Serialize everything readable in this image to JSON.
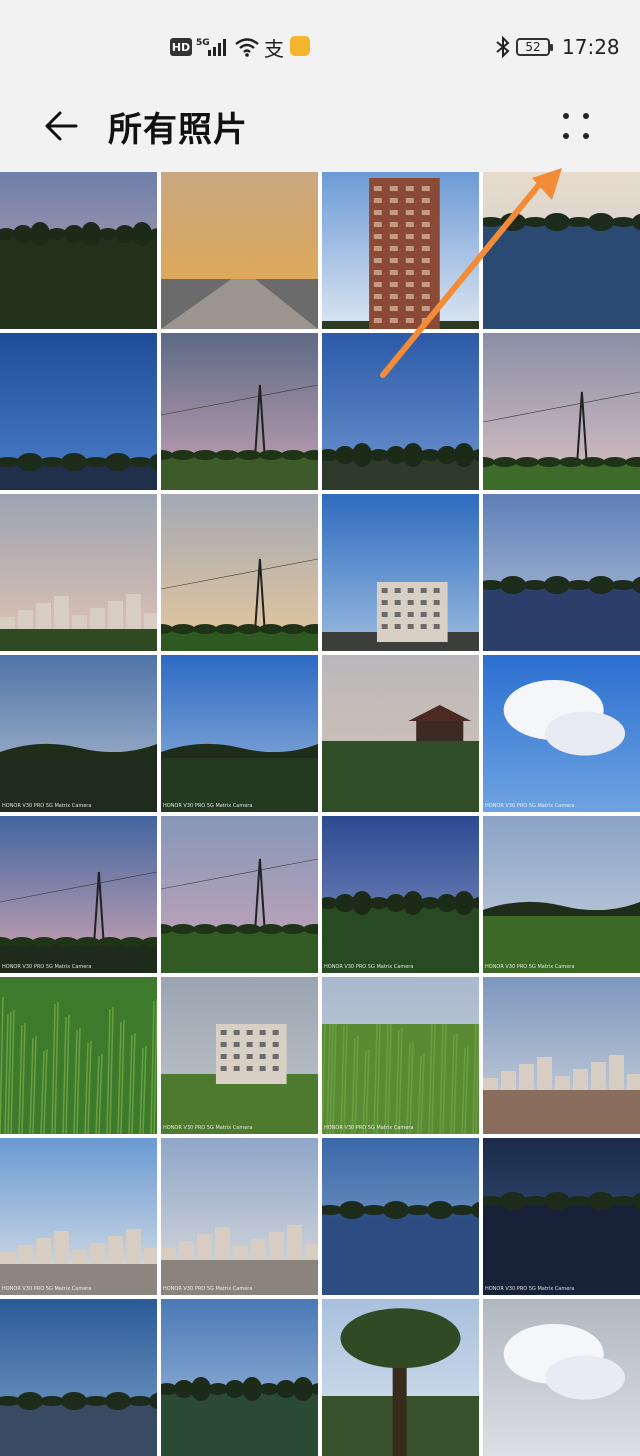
{
  "status_bar": {
    "hd": "HD",
    "network": "5G",
    "pay_icon": "支",
    "battery": "52",
    "time": "17:28",
    "icons": [
      "hd-icon",
      "signal-5g-icon",
      "wifi-icon",
      "alipay-icon",
      "app-notification-icon",
      "bluetooth-icon",
      "battery-icon"
    ]
  },
  "header": {
    "title": "所有照片",
    "back_icon": "back-arrow-icon",
    "more_icon": "more-dots-icon"
  },
  "grid": {
    "photos": [
      {
        "sky": [
          "#6e7fa8",
          "#c7a6b6"
        ],
        "ground": "#23301c",
        "horizon": 0.42,
        "feature": "trees"
      },
      {
        "sky": [
          "#c9a780",
          "#e5a84a"
        ],
        "ground": "#6b6b6b",
        "horizon": 0.68,
        "feature": "road"
      },
      {
        "sky": [
          "#6d9ad6",
          "#dce6f2"
        ],
        "ground": "#2c3a22",
        "horizon": 0.95,
        "feature": "tower"
      },
      {
        "sky": [
          "#e8dccb",
          "#c2ccd2"
        ],
        "ground": "#2b4a73",
        "horizon": 0.32,
        "feature": "lake"
      },
      {
        "sky": [
          "#1f4c99",
          "#4c7fc9"
        ],
        "ground": "#20304a",
        "horizon": 0.82,
        "feature": "lake"
      },
      {
        "sky": [
          "#5d6a86",
          "#c6a3b3"
        ],
        "ground": "#3d5b2a",
        "horizon": 0.78,
        "feature": "pylon"
      },
      {
        "sky": [
          "#2c5aa8",
          "#6e95d1"
        ],
        "ground": "#2e3b2a",
        "horizon": 0.8,
        "feature": "trees"
      },
      {
        "sky": [
          "#8a8fa6",
          "#d9c0c2"
        ],
        "ground": "#3d6b2a",
        "horizon": 0.82,
        "feature": "pylon"
      },
      {
        "sky": [
          "#9da4b2",
          "#e1c3b3"
        ],
        "ground": "#2d4a22",
        "horizon": 0.86,
        "feature": "buildings"
      },
      {
        "sky": [
          "#a4a9b4",
          "#e7c89c"
        ],
        "ground": "#2e5a22",
        "horizon": 0.86,
        "feature": "pylon"
      },
      {
        "sky": [
          "#2f6bbf",
          "#9bbcdf"
        ],
        "ground": "#3b3e3b",
        "horizon": 0.88,
        "feature": "building"
      },
      {
        "sky": [
          "#5f7fb8",
          "#b8c6dc"
        ],
        "ground": "#2c3e6a",
        "horizon": 0.58,
        "feature": "lake"
      },
      {
        "sky": [
          "#4f74a8",
          "#b7c2d2"
        ],
        "ground": "#1f2b1c",
        "horizon": 0.62,
        "feature": "hills"
      },
      {
        "sky": [
          "#2d6ac4",
          "#9db9dc"
        ],
        "ground": "#24391f",
        "horizon": 0.62,
        "feature": "hills"
      },
      {
        "sky": [
          "#b9b7bb",
          "#d8c6b6"
        ],
        "ground": "#2f4d27",
        "horizon": 0.55,
        "feature": "pavilion"
      },
      {
        "sky": [
          "#2b6fd0",
          "#6ea3e2"
        ],
        "ground": "#2b6fd0",
        "horizon": 1.0,
        "feature": "clouds"
      },
      {
        "sky": [
          "#41659f",
          "#d1a6b3"
        ],
        "ground": "#1e2b1b",
        "horizon": 0.8,
        "feature": "pylon"
      },
      {
        "sky": [
          "#8797b8",
          "#c8a5b9"
        ],
        "ground": "#325a23",
        "horizon": 0.72,
        "feature": "pylon"
      },
      {
        "sky": [
          "#2c4a92",
          "#8696c4"
        ],
        "ground": "#284a22",
        "horizon": 0.58,
        "feature": "trees"
      },
      {
        "sky": [
          "#8aa3c6",
          "#c9d2de"
        ],
        "ground": "#3c6a26",
        "horizon": 0.6,
        "feature": "hills"
      },
      {
        "sky": [
          "#3f7a2c",
          "#4f8c34"
        ],
        "ground": "#3e7a2b",
        "horizon": 0.0,
        "feature": "grass"
      },
      {
        "sky": [
          "#9aa4b0",
          "#c4c8ce"
        ],
        "ground": "#4d7a2e",
        "horizon": 0.62,
        "feature": "building"
      },
      {
        "sky": [
          "#a9b8cd",
          "#cfd4da"
        ],
        "ground": "#5a8a34",
        "horizon": 0.3,
        "feature": "grass"
      },
      {
        "sky": [
          "#7d97bf",
          "#d0d5dc"
        ],
        "ground": "#8a6c5c",
        "horizon": 0.72,
        "feature": "city"
      },
      {
        "sky": [
          "#6a9ad2",
          "#dde2e8"
        ],
        "ground": "#8c8680",
        "horizon": 0.8,
        "feature": "city"
      },
      {
        "sky": [
          "#8fa6c8",
          "#dcdcdc"
        ],
        "ground": "#8a847c",
        "horizon": 0.78,
        "feature": "city"
      },
      {
        "sky": [
          "#3b68a8",
          "#8aa9cf"
        ],
        "ground": "#2d4e82",
        "horizon": 0.46,
        "feature": "lake"
      },
      {
        "sky": [
          "#1c2b49",
          "#395b87"
        ],
        "ground": "#172238",
        "horizon": 0.4,
        "feature": "lake"
      },
      {
        "sky": [
          "#2a5a98",
          "#7fa2c9"
        ],
        "ground": "#3a4a63",
        "horizon": 0.65,
        "feature": "lake"
      },
      {
        "sky": [
          "#4b79b6",
          "#a8c0de"
        ],
        "ground": "#2a4a34",
        "horizon": 0.6,
        "feature": "trees"
      },
      {
        "sky": [
          "#a8c0de",
          "#dbe4ee"
        ],
        "ground": "#37522d",
        "horizon": 0.62,
        "feature": "tree"
      },
      {
        "sky": [
          "#b2b8c0",
          "#dcdfe3"
        ],
        "ground": "#b2b8c0",
        "horizon": 1.0,
        "feature": "clouds"
      }
    ],
    "watermark": "HONOR V30 PRO 5G\nMatrix Camera"
  },
  "annotation": {
    "color": "#f28c38"
  }
}
